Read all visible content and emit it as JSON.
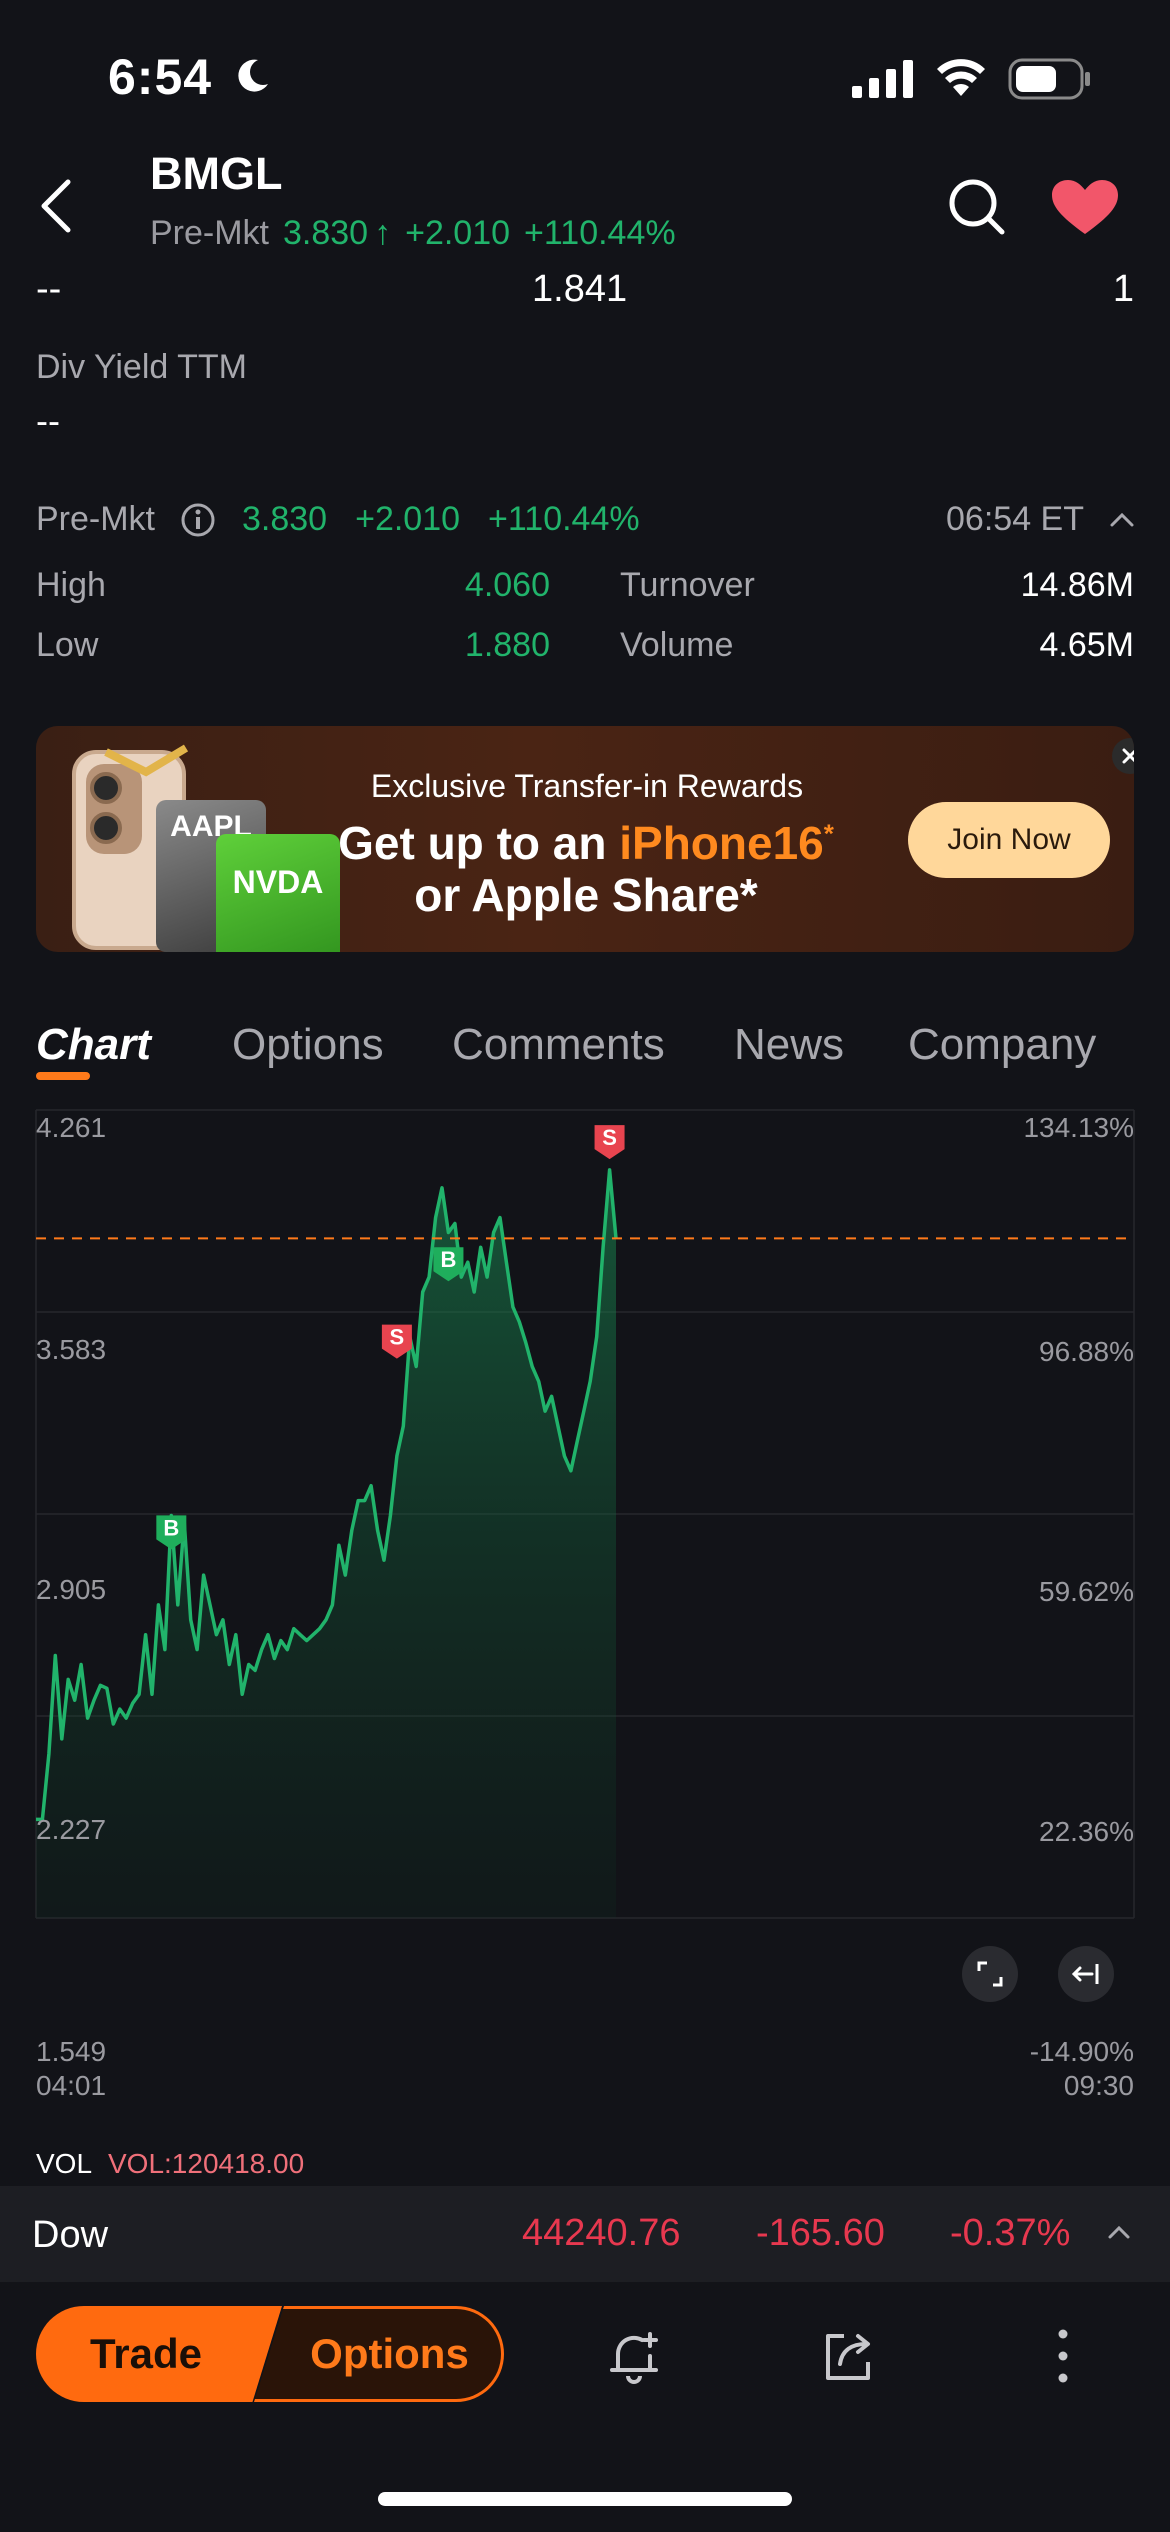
{
  "status_bar": {
    "time": "6:54"
  },
  "header": {
    "ticker": "BMGL",
    "premkt_label": "Pre-Mkt",
    "premkt_price": "3.830",
    "premkt_change": "+2.010",
    "premkt_pct": "+110.44%"
  },
  "summary_row": {
    "left": "--",
    "mid": "1.841",
    "right": "1"
  },
  "div_yield": {
    "label": "Div Yield TTM",
    "value": "--"
  },
  "premarket": {
    "label": "Pre-Mkt",
    "price": "3.830",
    "change": "+2.010",
    "pct": "+110.44%",
    "time": "06:54 ET",
    "high_label": "High",
    "high": "4.060",
    "low_label": "Low",
    "low": "1.880",
    "turnover_label": "Turnover",
    "turnover": "14.86M",
    "volume_label": "Volume",
    "volume": "4.65M"
  },
  "banner": {
    "line1": "Exclusive Transfer-in Rewards",
    "line2_prefix": "Get up to an ",
    "line2_highlight": "iPhone16",
    "line2_star": "*",
    "line3": "or Apple Share*",
    "card_aapl": "AAPL",
    "card_nvda": "NVDA",
    "cta": "Join Now"
  },
  "tabs": [
    "Chart",
    "Options",
    "Comments",
    "News",
    "Company"
  ],
  "chart_data": {
    "type": "line",
    "y_left_ticks": [
      "4.261",
      "3.583",
      "2.905",
      "2.227",
      "1.549"
    ],
    "y_right_ticks": [
      "134.13%",
      "96.88%",
      "59.62%",
      "22.36%",
      "-14.90%"
    ],
    "x_ticks": [
      "04:01",
      "09:30"
    ],
    "ylim": [
      1.549,
      4.261
    ],
    "reference_line": 3.83,
    "x": [
      0,
      1,
      2,
      3,
      4,
      5,
      6,
      7,
      8,
      9,
      10,
      11,
      12,
      13,
      14,
      15,
      16,
      17,
      18,
      19,
      20,
      21,
      22,
      23,
      24,
      25,
      26,
      27,
      28,
      29,
      30,
      31,
      32,
      33,
      34,
      35,
      36,
      37,
      38,
      39,
      40,
      41,
      42,
      43,
      44,
      45,
      46,
      47,
      48,
      49,
      50,
      51,
      52,
      53,
      54,
      55,
      56,
      57,
      58,
      59,
      60,
      61,
      62,
      63,
      64,
      65,
      66,
      67,
      68,
      69,
      70,
      71,
      72,
      73,
      74,
      75,
      76,
      77,
      78,
      79,
      80,
      81,
      82,
      83,
      84,
      85,
      86,
      87,
      88,
      89,
      90,
      91,
      92,
      93,
      94,
      95,
      96,
      97,
      98,
      99,
      100,
      101,
      102,
      103,
      104,
      105,
      106,
      107,
      108,
      109,
      110,
      111,
      112,
      113,
      114,
      115,
      116,
      117,
      118,
      119,
      120,
      121,
      122,
      123,
      124,
      125,
      126,
      127,
      128,
      129,
      130,
      131,
      132,
      133,
      134,
      135,
      136,
      137,
      138,
      139,
      140
    ],
    "values": [
      1.88,
      1.88,
      2.1,
      2.43,
      2.15,
      2.35,
      2.28,
      2.4,
      2.22,
      2.28,
      2.33,
      2.32,
      2.2,
      2.25,
      2.22,
      2.27,
      2.3,
      2.5,
      2.3,
      2.6,
      2.45,
      2.9,
      2.6,
      2.88,
      2.55,
      2.45,
      2.7,
      2.6,
      2.5,
      2.55,
      2.4,
      2.5,
      2.3,
      2.4,
      2.38,
      2.45,
      2.5,
      2.42,
      2.48,
      2.45,
      2.52,
      2.5,
      2.48,
      2.5,
      2.52,
      2.55,
      2.6,
      2.8,
      2.7,
      2.85,
      2.95,
      2.95,
      3.0,
      2.85,
      2.75,
      2.9,
      3.1,
      3.2,
      3.5,
      3.4,
      3.65,
      3.7,
      3.9,
      4.0,
      3.85,
      3.88,
      3.7,
      3.75,
      3.65,
      3.8,
      3.7,
      3.85,
      3.9,
      3.75,
      3.6,
      3.55,
      3.48,
      3.4,
      3.35,
      3.25,
      3.3,
      3.2,
      3.1,
      3.05,
      3.15,
      3.25,
      3.35,
      3.5,
      3.8,
      4.06,
      3.83
    ],
    "markers": [
      {
        "label": "B",
        "value": 2.84,
        "kind": "buy"
      },
      {
        "label": "S",
        "value": 3.48,
        "kind": "sell"
      },
      {
        "label": "B",
        "value": 3.74,
        "kind": "buy"
      },
      {
        "label": "S",
        "value": 4.15,
        "kind": "sell"
      }
    ],
    "volume_label": "VOL",
    "volume_value": "VOL:120418.00"
  },
  "index": {
    "name": "Dow",
    "price": "44240.76",
    "change": "-165.60",
    "pct": "-0.37%"
  },
  "bottom": {
    "trade": "Trade",
    "options": "Options"
  },
  "colors": {
    "accent": "#ff6a0f",
    "up": "#21b36b",
    "down": "#e8384f",
    "background": "#121318"
  }
}
